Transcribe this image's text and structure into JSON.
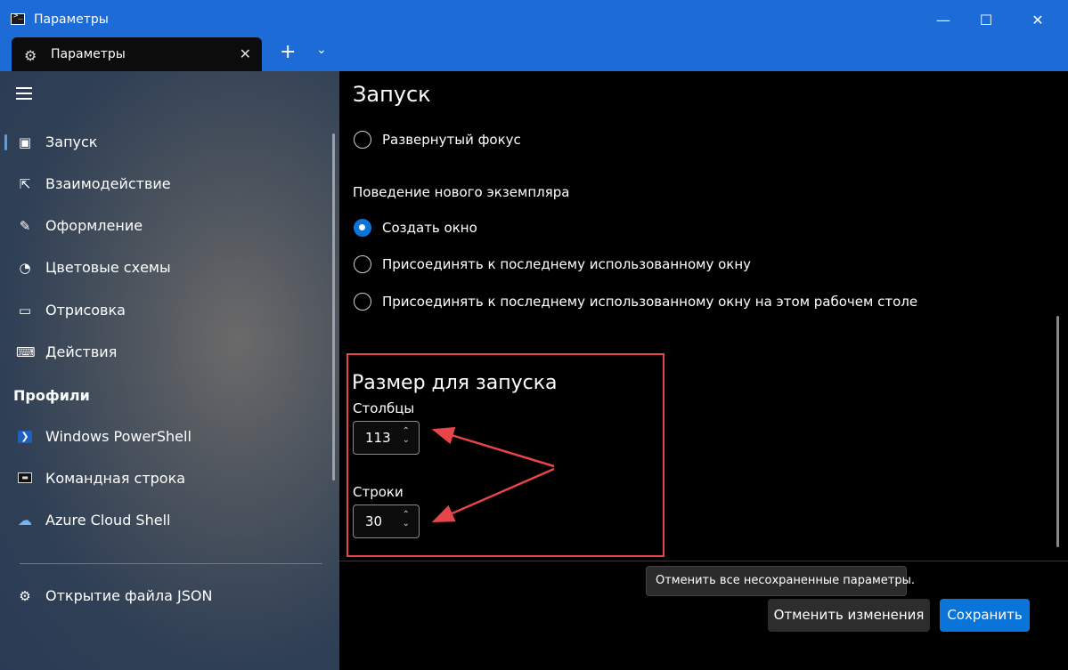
{
  "window": {
    "title": "Параметры",
    "terminal_icon_glyph": ">_",
    "minimize_glyph": "—",
    "maximize_glyph": "☐",
    "close_glyph": "✕"
  },
  "tab": {
    "label": "Параметры",
    "icon": "gear-icon",
    "close_glyph": "✕",
    "newtab_glyph": "+",
    "dropdown_glyph": "⌄"
  },
  "sidebar": {
    "items": [
      {
        "label": "Запуск",
        "icon": "launch-icon",
        "glyph": "▣",
        "active": true
      },
      {
        "label": "Взаимодействие",
        "icon": "interaction-icon",
        "glyph": "⇱"
      },
      {
        "label": "Оформление",
        "icon": "brush-icon",
        "glyph": "✎"
      },
      {
        "label": "Цветовые схемы",
        "icon": "palette-icon",
        "glyph": "◔"
      },
      {
        "label": "Отрисовка",
        "icon": "monitor-icon",
        "glyph": "▭"
      },
      {
        "label": "Действия",
        "icon": "keyboard-icon",
        "glyph": "⌨"
      }
    ],
    "profiles_header": "Профили",
    "profiles": [
      {
        "label": "Windows PowerShell",
        "icon": "powershell-icon",
        "glyph": "❯"
      },
      {
        "label": "Командная строка",
        "icon": "cmd-icon",
        "glyph": "▬"
      },
      {
        "label": "Azure Cloud Shell",
        "icon": "azure-cloud-icon",
        "glyph": "☁"
      }
    ],
    "json_item": {
      "label": "Открытие файла JSON",
      "icon": "gear-icon",
      "glyph": "⚙"
    }
  },
  "main": {
    "title": "Запуск",
    "focus_option": "Развернутый фокус",
    "new_instance_label": "Поведение нового экземпляра",
    "new_instance_options": [
      {
        "label": "Создать окно",
        "checked": true
      },
      {
        "label": "Присоединять к последнему использованному окну",
        "checked": false
      },
      {
        "label": "Присоединять к последнему использованному окну на этом рабочем столе",
        "checked": false
      }
    ],
    "launch_size_title": "Размер для запуска",
    "columns_label": "Столбцы",
    "columns_value": "113",
    "rows_label": "Строки",
    "rows_value": "30"
  },
  "footer": {
    "tooltip": "Отменить все несохраненные параметры.",
    "discard_label": "Отменить изменения",
    "save_label": "Сохранить"
  },
  "colors": {
    "titlebar": "#1d6bd6",
    "accent": "#0a74d8",
    "annotation": "#e8454a"
  }
}
